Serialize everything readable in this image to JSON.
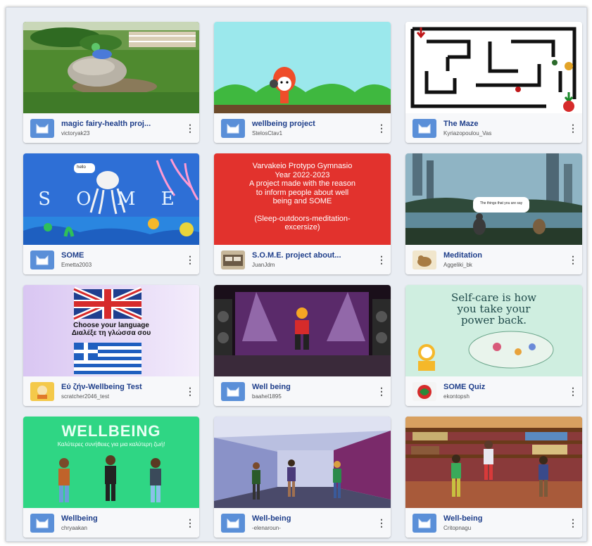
{
  "projects": [
    {
      "title": "magic fairy-health proj...",
      "author": "victoryak23"
    },
    {
      "title": "wellbeing project",
      "author": "StelosCtav1"
    },
    {
      "title": "The Maze",
      "author": "Kyriazopoulou_Vas"
    },
    {
      "title": "SOME",
      "author": "Emetta2003",
      "thumb_text": "S O M E",
      "bubble": "hello"
    },
    {
      "title": "S.O.M.E. project about...",
      "author": "JuanJdm",
      "thumb_lines": [
        "Varvakeio Protypo Gymnasio",
        "Year 2022-2023",
        "A project made with the reason",
        "to inform people about well",
        "being and SOME",
        "",
        "(Sleep-outdoors-meditation-",
        "excersize)"
      ]
    },
    {
      "title": "Meditation",
      "author": "Aggeliki_bk",
      "bubble": "The things that you are say"
    },
    {
      "title": "Εύ ζήν-Wellbeing Test",
      "author": "scratcher2046_test",
      "thumb_lines": [
        "Choose your language",
        "Διαλέξε τη γλώσσα σου"
      ]
    },
    {
      "title": "Well being",
      "author": "baahel1895"
    },
    {
      "title": "SOME Quiz",
      "author": "ekontopsh",
      "thumb_lines": [
        "Self-care is how",
        "you take your",
        "power back."
      ]
    },
    {
      "title": "Wellbeing",
      "author": "chryaakan",
      "thumb_lines": [
        "WELLBEING",
        "Καλύτερες συνήθειες για μια καλύτερη ζωή!"
      ]
    },
    {
      "title": "Well-being",
      "author": "-elenaroun-"
    },
    {
      "title": "Well-being",
      "author": "Critopnagu"
    }
  ],
  "icons": {
    "card_menu": "more-vertical-icon",
    "default_avatar": "scratch-cat-icon"
  },
  "colors": {
    "title": "#1e3e8a",
    "avatar_default": "#5a8fd8",
    "card_red": "#e2322d",
    "card_green": "#2fd684"
  }
}
